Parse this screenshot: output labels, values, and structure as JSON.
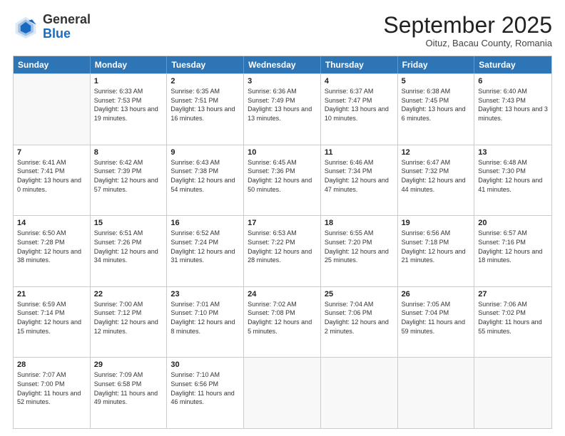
{
  "logo": {
    "general": "General",
    "blue": "Blue"
  },
  "title": "September 2025",
  "subtitle": "Oituz, Bacau County, Romania",
  "header_days": [
    "Sunday",
    "Monday",
    "Tuesday",
    "Wednesday",
    "Thursday",
    "Friday",
    "Saturday"
  ],
  "weeks": [
    [
      {
        "day": "",
        "sunrise": "",
        "sunset": "",
        "daylight": "",
        "empty": true
      },
      {
        "day": "1",
        "sunrise": "Sunrise: 6:33 AM",
        "sunset": "Sunset: 7:53 PM",
        "daylight": "Daylight: 13 hours and 19 minutes."
      },
      {
        "day": "2",
        "sunrise": "Sunrise: 6:35 AM",
        "sunset": "Sunset: 7:51 PM",
        "daylight": "Daylight: 13 hours and 16 minutes."
      },
      {
        "day": "3",
        "sunrise": "Sunrise: 6:36 AM",
        "sunset": "Sunset: 7:49 PM",
        "daylight": "Daylight: 13 hours and 13 minutes."
      },
      {
        "day": "4",
        "sunrise": "Sunrise: 6:37 AM",
        "sunset": "Sunset: 7:47 PM",
        "daylight": "Daylight: 13 hours and 10 minutes."
      },
      {
        "day": "5",
        "sunrise": "Sunrise: 6:38 AM",
        "sunset": "Sunset: 7:45 PM",
        "daylight": "Daylight: 13 hours and 6 minutes."
      },
      {
        "day": "6",
        "sunrise": "Sunrise: 6:40 AM",
        "sunset": "Sunset: 7:43 PM",
        "daylight": "Daylight: 13 hours and 3 minutes."
      }
    ],
    [
      {
        "day": "7",
        "sunrise": "Sunrise: 6:41 AM",
        "sunset": "Sunset: 7:41 PM",
        "daylight": "Daylight: 13 hours and 0 minutes."
      },
      {
        "day": "8",
        "sunrise": "Sunrise: 6:42 AM",
        "sunset": "Sunset: 7:39 PM",
        "daylight": "Daylight: 12 hours and 57 minutes."
      },
      {
        "day": "9",
        "sunrise": "Sunrise: 6:43 AM",
        "sunset": "Sunset: 7:38 PM",
        "daylight": "Daylight: 12 hours and 54 minutes."
      },
      {
        "day": "10",
        "sunrise": "Sunrise: 6:45 AM",
        "sunset": "Sunset: 7:36 PM",
        "daylight": "Daylight: 12 hours and 50 minutes."
      },
      {
        "day": "11",
        "sunrise": "Sunrise: 6:46 AM",
        "sunset": "Sunset: 7:34 PM",
        "daylight": "Daylight: 12 hours and 47 minutes."
      },
      {
        "day": "12",
        "sunrise": "Sunrise: 6:47 AM",
        "sunset": "Sunset: 7:32 PM",
        "daylight": "Daylight: 12 hours and 44 minutes."
      },
      {
        "day": "13",
        "sunrise": "Sunrise: 6:48 AM",
        "sunset": "Sunset: 7:30 PM",
        "daylight": "Daylight: 12 hours and 41 minutes."
      }
    ],
    [
      {
        "day": "14",
        "sunrise": "Sunrise: 6:50 AM",
        "sunset": "Sunset: 7:28 PM",
        "daylight": "Daylight: 12 hours and 38 minutes."
      },
      {
        "day": "15",
        "sunrise": "Sunrise: 6:51 AM",
        "sunset": "Sunset: 7:26 PM",
        "daylight": "Daylight: 12 hours and 34 minutes."
      },
      {
        "day": "16",
        "sunrise": "Sunrise: 6:52 AM",
        "sunset": "Sunset: 7:24 PM",
        "daylight": "Daylight: 12 hours and 31 minutes."
      },
      {
        "day": "17",
        "sunrise": "Sunrise: 6:53 AM",
        "sunset": "Sunset: 7:22 PM",
        "daylight": "Daylight: 12 hours and 28 minutes."
      },
      {
        "day": "18",
        "sunrise": "Sunrise: 6:55 AM",
        "sunset": "Sunset: 7:20 PM",
        "daylight": "Daylight: 12 hours and 25 minutes."
      },
      {
        "day": "19",
        "sunrise": "Sunrise: 6:56 AM",
        "sunset": "Sunset: 7:18 PM",
        "daylight": "Daylight: 12 hours and 21 minutes."
      },
      {
        "day": "20",
        "sunrise": "Sunrise: 6:57 AM",
        "sunset": "Sunset: 7:16 PM",
        "daylight": "Daylight: 12 hours and 18 minutes."
      }
    ],
    [
      {
        "day": "21",
        "sunrise": "Sunrise: 6:59 AM",
        "sunset": "Sunset: 7:14 PM",
        "daylight": "Daylight: 12 hours and 15 minutes."
      },
      {
        "day": "22",
        "sunrise": "Sunrise: 7:00 AM",
        "sunset": "Sunset: 7:12 PM",
        "daylight": "Daylight: 12 hours and 12 minutes."
      },
      {
        "day": "23",
        "sunrise": "Sunrise: 7:01 AM",
        "sunset": "Sunset: 7:10 PM",
        "daylight": "Daylight: 12 hours and 8 minutes."
      },
      {
        "day": "24",
        "sunrise": "Sunrise: 7:02 AM",
        "sunset": "Sunset: 7:08 PM",
        "daylight": "Daylight: 12 hours and 5 minutes."
      },
      {
        "day": "25",
        "sunrise": "Sunrise: 7:04 AM",
        "sunset": "Sunset: 7:06 PM",
        "daylight": "Daylight: 12 hours and 2 minutes."
      },
      {
        "day": "26",
        "sunrise": "Sunrise: 7:05 AM",
        "sunset": "Sunset: 7:04 PM",
        "daylight": "Daylight: 11 hours and 59 minutes."
      },
      {
        "day": "27",
        "sunrise": "Sunrise: 7:06 AM",
        "sunset": "Sunset: 7:02 PM",
        "daylight": "Daylight: 11 hours and 55 minutes."
      }
    ],
    [
      {
        "day": "28",
        "sunrise": "Sunrise: 7:07 AM",
        "sunset": "Sunset: 7:00 PM",
        "daylight": "Daylight: 11 hours and 52 minutes."
      },
      {
        "day": "29",
        "sunrise": "Sunrise: 7:09 AM",
        "sunset": "Sunset: 6:58 PM",
        "daylight": "Daylight: 11 hours and 49 minutes."
      },
      {
        "day": "30",
        "sunrise": "Sunrise: 7:10 AM",
        "sunset": "Sunset: 6:56 PM",
        "daylight": "Daylight: 11 hours and 46 minutes."
      },
      {
        "day": "",
        "sunrise": "",
        "sunset": "",
        "daylight": "",
        "empty": true
      },
      {
        "day": "",
        "sunrise": "",
        "sunset": "",
        "daylight": "",
        "empty": true
      },
      {
        "day": "",
        "sunrise": "",
        "sunset": "",
        "daylight": "",
        "empty": true
      },
      {
        "day": "",
        "sunrise": "",
        "sunset": "",
        "daylight": "",
        "empty": true
      }
    ]
  ]
}
